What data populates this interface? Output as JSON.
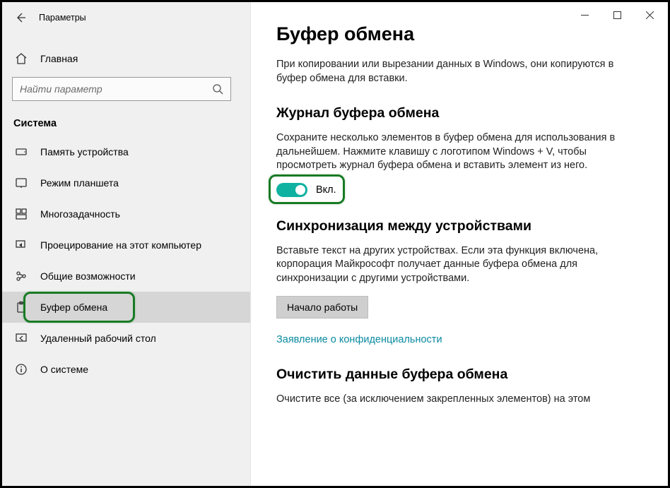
{
  "window": {
    "title": "Параметры"
  },
  "sidebar": {
    "home_label": "Главная",
    "search_placeholder": "Найти параметр",
    "group_title": "Система",
    "items": [
      {
        "label": "Память устройства"
      },
      {
        "label": "Режим планшета"
      },
      {
        "label": "Многозадачность"
      },
      {
        "label": "Проецирование на этот компьютер"
      },
      {
        "label": "Общие возможности"
      },
      {
        "label": "Буфер обмена"
      },
      {
        "label": "Удаленный рабочий стол"
      },
      {
        "label": "О системе"
      }
    ]
  },
  "main": {
    "h1": "Буфер обмена",
    "intro": "При копировании или вырезании данных в Windows, они копируются в буфер обмена для вставки.",
    "section1": {
      "title": "Журнал буфера обмена",
      "desc": "Сохраните несколько элементов в буфер обмена для использования в дальнейшем. Нажмите клавишу с логотипом Windows + V, чтобы просмотреть журнал буфера обмена и вставить элемент из него.",
      "toggle_label": "Вкл."
    },
    "section2": {
      "title": "Синхронизация между устройствами",
      "desc": "Вставьте текст на других устройствах. Если эта функция включена, корпорация Майкрософт получает данные буфера обмена для синхронизации с другими устройствами.",
      "button": "Начало работы",
      "link": "Заявление о конфиденциальности"
    },
    "section3": {
      "title": "Очистить данные буфера обмена",
      "desc": "Очистите все (за исключением закрепленных элементов) на этом"
    }
  }
}
